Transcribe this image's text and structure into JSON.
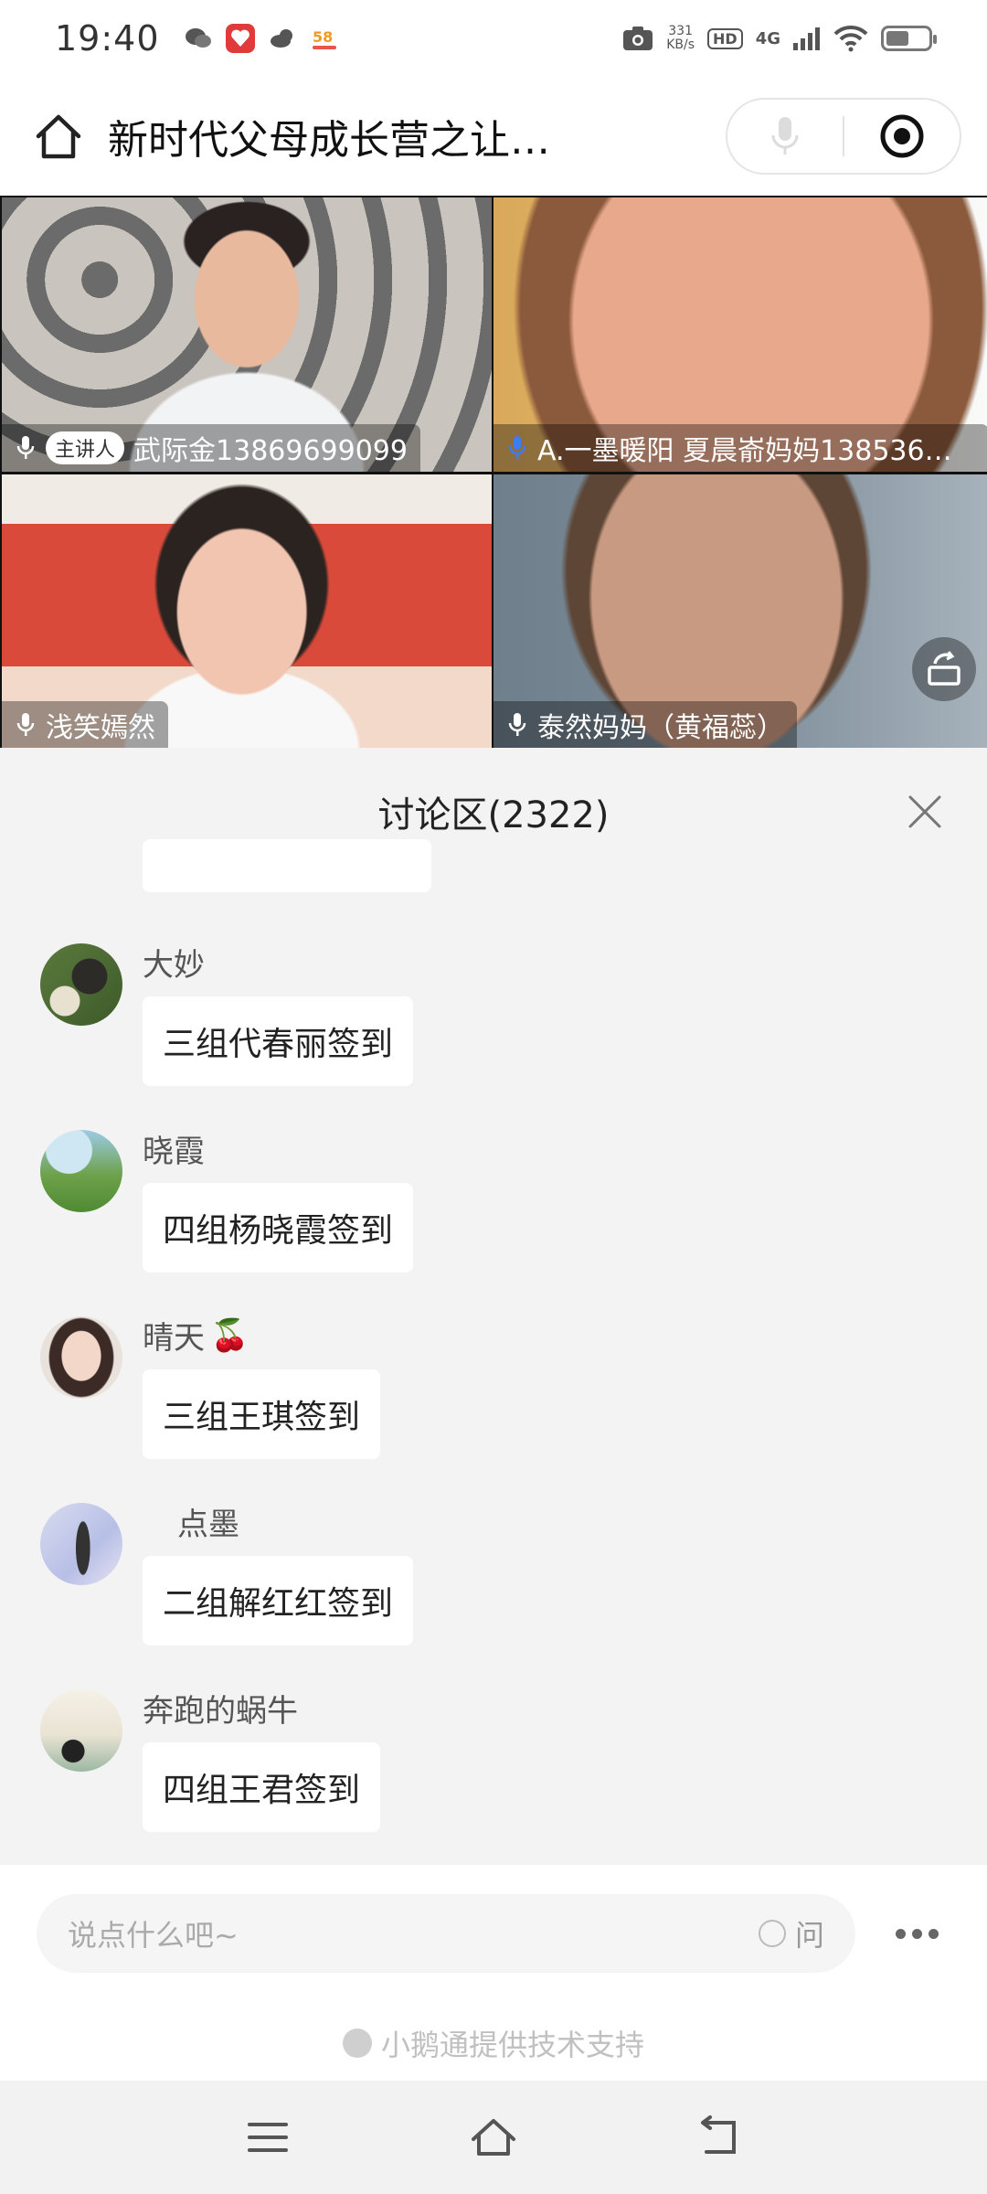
{
  "status_bar": {
    "time": "19:40",
    "network_speed_value": "331",
    "network_speed_unit": "KB/s",
    "hd_label": "HD",
    "network_type": "4G",
    "icons": [
      "wechat-icon",
      "app-icon",
      "weather-icon",
      "app58-icon",
      "camera-icon",
      "signal-icon",
      "wifi-icon",
      "battery-icon"
    ]
  },
  "header": {
    "title": "新时代父母成长营之让…"
  },
  "video_tiles": [
    {
      "badge": "主讲人",
      "name": "武际金13869699099",
      "mic": "mic-icon"
    },
    {
      "badge": "",
      "name": "A.一墨暖阳 夏晨嵛妈妈138536…",
      "mic": "mic-active-icon"
    },
    {
      "badge": "",
      "name": "浅笑嫣然",
      "mic": "mic-icon"
    },
    {
      "badge": "",
      "name": "泰然妈妈（黄福蕊）",
      "mic": "mic-icon"
    }
  ],
  "discussion": {
    "title": "讨论区(2322)",
    "messages": [
      {
        "name": "大妙",
        "text": "三组代春丽签到"
      },
      {
        "name": "晓霞",
        "text": "四组杨晓霞签到"
      },
      {
        "name": "晴天",
        "name_emoji": "🍒",
        "text": "三组王琪签到"
      },
      {
        "name": "  点墨",
        "text": "二组解红红签到"
      },
      {
        "name": "奔跑的蜗牛",
        "text": "四组王君签到"
      }
    ]
  },
  "input": {
    "placeholder": "说点什么吧~",
    "ask_label": "问"
  },
  "footer": {
    "powered_by": "小鹅通提供技术支持"
  }
}
